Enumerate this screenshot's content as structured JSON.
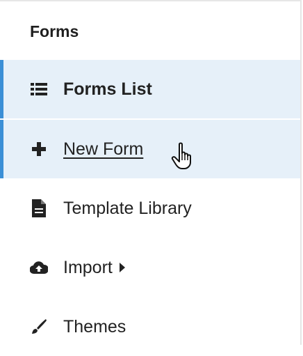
{
  "menu": {
    "title": "Forms",
    "items": [
      {
        "label": "Forms List",
        "icon": "list-icon",
        "active": true
      },
      {
        "label": "New Form",
        "icon": "plus-icon",
        "active": true
      },
      {
        "label": "Template Library",
        "icon": "document-icon",
        "active": false
      },
      {
        "label": "Import",
        "icon": "cloud-upload-icon",
        "active": false,
        "submenu": true
      },
      {
        "label": "Themes",
        "icon": "brush-icon",
        "active": false
      }
    ]
  },
  "colors": {
    "active_bg": "#e6f0f9",
    "accent": "#3b8fd6"
  }
}
